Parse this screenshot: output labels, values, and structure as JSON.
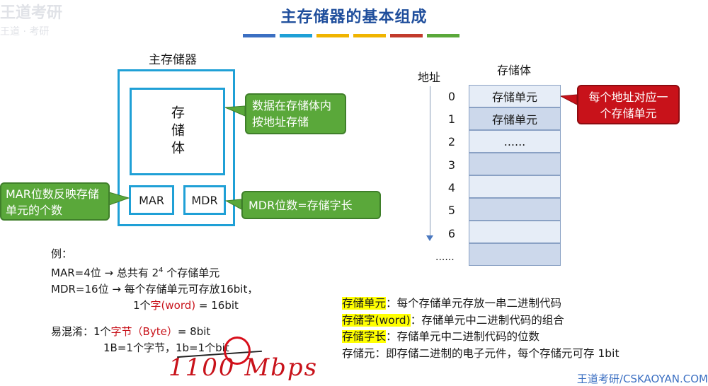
{
  "title": "主存储器的基本组成",
  "title_bar_colors": [
    "#3b6fc2",
    "#1fa0d6",
    "#f0b400",
    "#f0b400",
    "#c23a2b",
    "#5aa83a"
  ],
  "watermark": {
    "top_left_1": "王道考研",
    "top_left_2": "王道 · 考研",
    "bottom_right": "王道考研/CSKAOYAN.COM"
  },
  "diagram": {
    "main_memory_label": "主存储器",
    "storage_body": "存储体",
    "mar": "MAR",
    "mdr": "MDR",
    "callout_store": "数据在存储体内按地址存储",
    "callout_mar": "MAR位数反映存储单元的个数",
    "callout_mdr": "MDR位数=存储字长"
  },
  "memory_table": {
    "address_header": "地址",
    "body_header": "存储体",
    "addresses": [
      "0",
      "1",
      "2",
      "3",
      "4",
      "5",
      "6"
    ],
    "cells": [
      "存储单元",
      "存储单元",
      "......",
      "",
      "",
      "",
      "",
      ""
    ],
    "more": "......",
    "callout": "每个地址对应一个存储单元"
  },
  "example": {
    "label": "例：",
    "line1_a": "MAR=4位 → 总共有 2",
    "line1_sup": "4",
    "line1_b": " 个存储单元",
    "line2": "MDR=16位 → 每个存储单元可存放16bit，",
    "line3_a": "1个",
    "line3_red": "字(word)",
    "line3_b": " = 16bit",
    "confuse_a": "易混淆：1个",
    "confuse_red": "字节（Byte）",
    "confuse_b": "= 8bit",
    "line5": "1B=1个字节，1b=1个bit",
    "handwriting": "1100 Mbps"
  },
  "definitions": [
    {
      "term": "存储单元",
      "text": "：每个存储单元存放一串二进制代码",
      "highlight": true
    },
    {
      "term": "存储字(word)",
      "text": "：存储单元中二进制代码的组合",
      "highlight": true
    },
    {
      "term": "存储字长",
      "text": "：存储单元中二进制代码的位数",
      "highlight": true
    },
    {
      "term": "存储元",
      "text": "：即存储二进制的电子元件，每个存储元可存 1bit",
      "highlight": false
    }
  ]
}
